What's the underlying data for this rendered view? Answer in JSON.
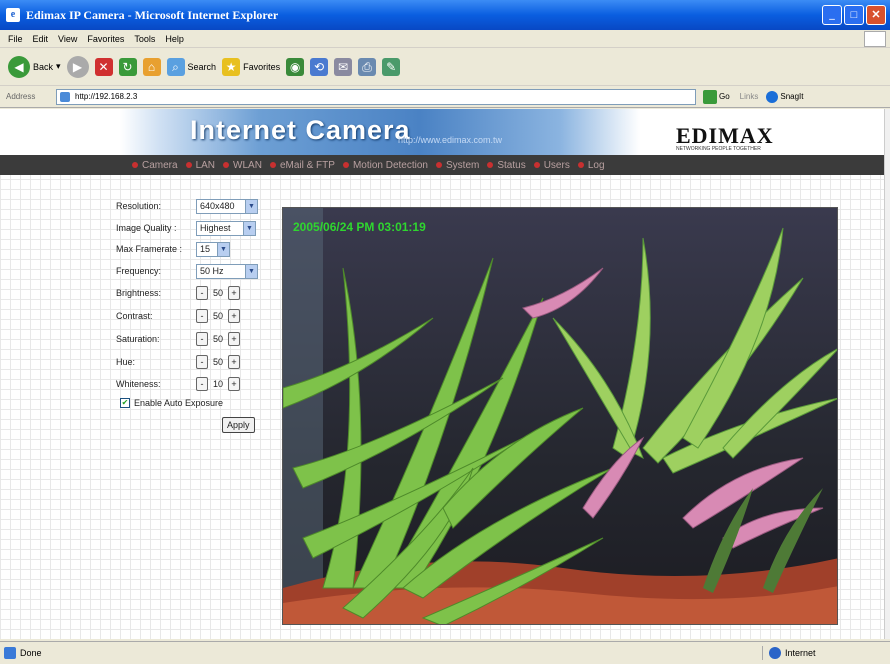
{
  "window": {
    "title": "Edimax IP Camera - Microsoft Internet Explorer",
    "controls": [
      "_",
      "□",
      "✕"
    ]
  },
  "menu": [
    "File",
    "Edit",
    "View",
    "Favorites",
    "Tools",
    "Help"
  ],
  "toolbar": {
    "back": "Back",
    "search": "Search",
    "favorites": "Favorites"
  },
  "address": {
    "label": "Address",
    "url": "http://192.168.2.3",
    "go": "Go",
    "links": "Links",
    "snagit": "SnagIt"
  },
  "banner": {
    "title": "Internet Camera",
    "url": "http://www.edimax.com.tw",
    "brand": "EDIMAX",
    "tagline": "NETWORKING PEOPLE TOGETHER"
  },
  "nav": [
    "Camera",
    "LAN",
    "WLAN",
    "eMail & FTP",
    "Motion Detection",
    "System",
    "Status",
    "Users",
    "Log"
  ],
  "settings": {
    "resolution": {
      "label": "Resolution:",
      "value": "640x480"
    },
    "quality": {
      "label": "Image Quality :",
      "value": "Highest"
    },
    "framerate": {
      "label": "Max Framerate :",
      "value": "15"
    },
    "frequency": {
      "label": "Frequency:",
      "value": "50 Hz"
    },
    "brightness": {
      "label": "Brightness:",
      "value": "50"
    },
    "contrast": {
      "label": "Contrast:",
      "value": "50"
    },
    "saturation": {
      "label": "Saturation:",
      "value": "50"
    },
    "hue": {
      "label": "Hue:",
      "value": "50"
    },
    "whiteness": {
      "label": "Whiteness:",
      "value": "10"
    },
    "minus": "-",
    "plus": "+",
    "auto_exposure": {
      "label": "Enable Auto Exposure",
      "checked": true
    },
    "apply": "Apply"
  },
  "viewer": {
    "timestamp": "2005/06/24 PM 03:01:19"
  },
  "status": {
    "left": "Done",
    "zone": "Internet"
  }
}
